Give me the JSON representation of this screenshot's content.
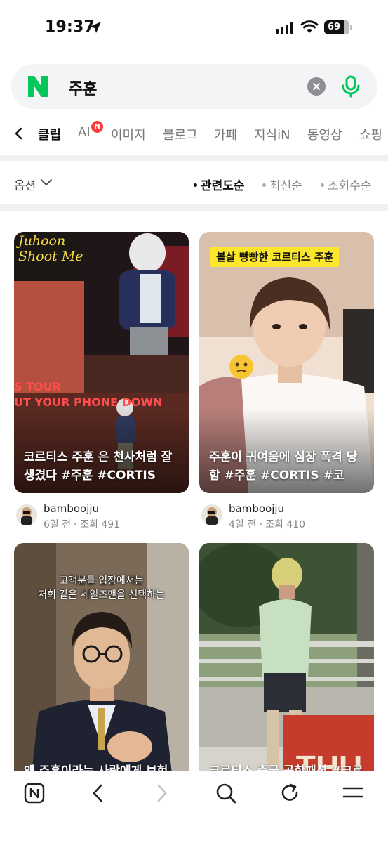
{
  "status_bar": {
    "time": "19:37",
    "battery": "69",
    "icons": [
      "location-arrow-icon",
      "signal-icon",
      "wifi-icon",
      "battery-icon"
    ]
  },
  "search": {
    "logo": "N",
    "query": "주훈",
    "clear_icon": "clear-icon",
    "mic_icon": "mic-icon",
    "brand_color": "#03c75a"
  },
  "tabs": [
    {
      "label": "클립",
      "active": true
    },
    {
      "label": "AI",
      "badge": "N"
    },
    {
      "label": "이미지"
    },
    {
      "label": "블로그"
    },
    {
      "label": "카페"
    },
    {
      "label": "지식iN"
    },
    {
      "label": "동영상"
    },
    {
      "label": "쇼핑"
    }
  ],
  "options": {
    "label": "옵션",
    "sort": [
      {
        "label": "관련도순",
        "active": true
      },
      {
        "label": "최신순"
      },
      {
        "label": "조회수순"
      }
    ]
  },
  "clips": [
    {
      "overlay_text": [
        "Juhoon",
        "Shoot Me",
        "S TOUR",
        "UT YOUR PHONE DOWN"
      ],
      "caption": "코르티스 주훈 은 천사처럼 잘 생겼다 #주훈 #CORTIS #...",
      "author": "bamboojju",
      "age": "6일 전",
      "views": "조회 491"
    },
    {
      "overlay_text": [
        "볼살 빵빵한 코르티스 주훈"
      ],
      "caption": "주훈이 귀여움에 심장 폭격 당함 #주훈 #CORTIS #코르...",
      "author": "bamboojju",
      "age": "4일 전",
      "views": "조회 410"
    },
    {
      "overlay_text": [
        "고객분들 입장에서는",
        "저희 같은 세일즈맨을 선택하는"
      ],
      "caption": "왜 주훈이라는 사람에게 보험"
    },
    {
      "caption": "코르티스 출국 공항패션 #코르"
    }
  ],
  "bottom_nav": [
    "naver-home-icon",
    "back-icon",
    "forward-icon",
    "search-icon",
    "refresh-icon",
    "menu-icon"
  ]
}
